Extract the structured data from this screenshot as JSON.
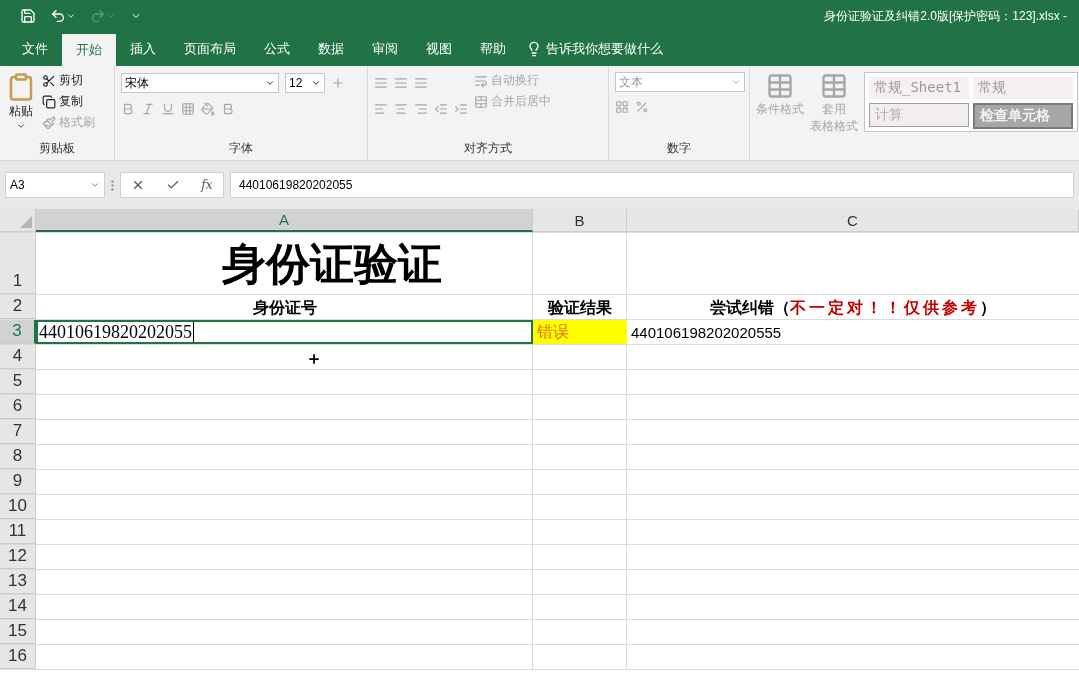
{
  "window": {
    "title": "身份证验证及纠错2.0版[保护密码：123].xlsx -"
  },
  "menu_tabs": [
    {
      "label": "文件",
      "selected": false
    },
    {
      "label": "开始",
      "selected": true
    },
    {
      "label": "插入",
      "selected": false
    },
    {
      "label": "页面布局",
      "selected": false
    },
    {
      "label": "公式",
      "selected": false
    },
    {
      "label": "数据",
      "selected": false
    },
    {
      "label": "审阅",
      "selected": false
    },
    {
      "label": "视图",
      "selected": false
    },
    {
      "label": "帮助",
      "selected": false
    }
  ],
  "tell_me": {
    "placeholder": "告诉我你想要做什么"
  },
  "ribbon": {
    "clipboard": {
      "label": "剪贴板",
      "paste": "粘贴",
      "items": [
        {
          "label": "剪切",
          "kind": "cut",
          "disabled": false
        },
        {
          "label": "复制",
          "kind": "copy",
          "disabled": false
        },
        {
          "label": "格式刷",
          "kind": "brush",
          "disabled": true
        }
      ]
    },
    "font": {
      "label": "字体",
      "font_name": "宋体",
      "font_size": "12"
    },
    "alignment": {
      "label": "对齐方式",
      "wrap": "自动换行",
      "merge": "合并后居中"
    },
    "number": {
      "label": "数字",
      "format": "文本"
    },
    "styles": {
      "conditional": "条件格式",
      "table_format": [
        "套用",
        "表格格式"
      ],
      "gallery": [
        {
          "label": "常规_Sheet1",
          "kind": "sheet"
        },
        {
          "label": "常规",
          "kind": "normal"
        },
        {
          "label": "计算",
          "kind": "calc"
        },
        {
          "label": "检查单元格",
          "kind": "check"
        }
      ]
    }
  },
  "formula_bar": {
    "name_box": "A3",
    "function_label": "fx",
    "value": "44010619820202055"
  },
  "columns": [
    {
      "label": "A",
      "selected": true
    },
    {
      "label": "B",
      "selected": false
    },
    {
      "label": "C",
      "selected": false
    }
  ],
  "rows": [
    {
      "header": "1",
      "selected": false,
      "cells": [
        {
          "kind": "title",
          "text": "身份证验证"
        }
      ]
    },
    {
      "header": "2",
      "selected": false,
      "cells": [
        {
          "kind": "header",
          "text": "身份证号"
        },
        {
          "kind": "header",
          "text": "验证结果"
        },
        {
          "kind": "header",
          "segments": [
            {
              "kind": "plain",
              "text": "尝试纠错（"
            },
            {
              "kind": "warning",
              "text": "不一定对！！仅供参考"
            },
            {
              "kind": "plain",
              "text": "）"
            }
          ]
        }
      ]
    },
    {
      "header": "3",
      "selected": true,
      "cells": [
        {
          "kind": "input",
          "text": "44010619820202055",
          "selected": true
        },
        {
          "kind": "error",
          "text": "错误"
        },
        {
          "kind": "plain",
          "text": "440106198202020555"
        }
      ]
    },
    {
      "header": "4",
      "selected": false
    },
    {
      "header": "5",
      "selected": false
    },
    {
      "header": "6",
      "selected": false
    },
    {
      "header": "7",
      "selected": false
    },
    {
      "header": "8",
      "selected": false
    },
    {
      "header": "9",
      "selected": false
    },
    {
      "header": "10",
      "selected": false
    },
    {
      "header": "11",
      "selected": false
    },
    {
      "header": "12",
      "selected": false
    },
    {
      "header": "13",
      "selected": false
    },
    {
      "header": "14",
      "selected": false
    },
    {
      "header": "15",
      "selected": false
    },
    {
      "header": "16",
      "selected": false
    }
  ]
}
